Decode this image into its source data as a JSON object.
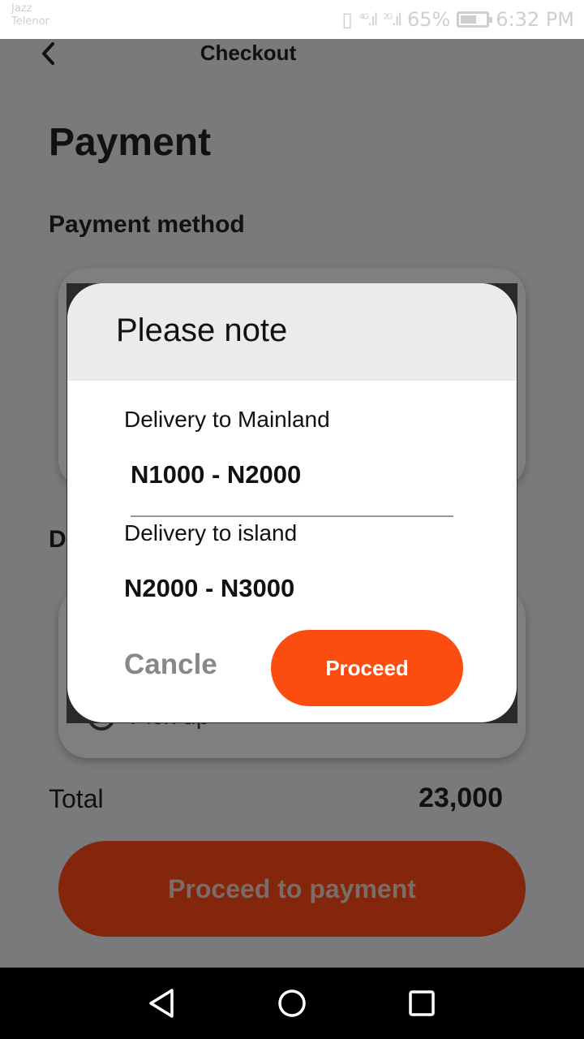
{
  "status_bar": {
    "carrier_1": "Jazz",
    "carrier_2": "Telenor",
    "network_1": "4G",
    "network_2": "2G",
    "battery": "65%",
    "time": "6:32 PM"
  },
  "header": {
    "title": "Checkout"
  },
  "page": {
    "title": "Payment",
    "payment_method_label": "Payment method",
    "delivery_label_partial": "D",
    "pickup_label": "Pick up",
    "total_label": "Total",
    "total_value": "23,000",
    "proceed_label": "Proceed to payment"
  },
  "dialog": {
    "title": "Please note",
    "mainland_label": "Delivery to Mainland",
    "mainland_price": "N1000 - N2000",
    "island_label": "Delivery to island",
    "island_price": "N2000 - N3000",
    "cancel_label": "Cancle",
    "proceed_label": "Proceed"
  },
  "colors": {
    "accent": "#fc4d10",
    "dimmed_button": "#83260c",
    "overlay": "#7a7a7c"
  },
  "icons": {
    "back": "chevron-left-icon",
    "nav_back": "triangle-back-icon",
    "nav_home": "circle-home-icon",
    "nav_recent": "square-recent-icon"
  }
}
